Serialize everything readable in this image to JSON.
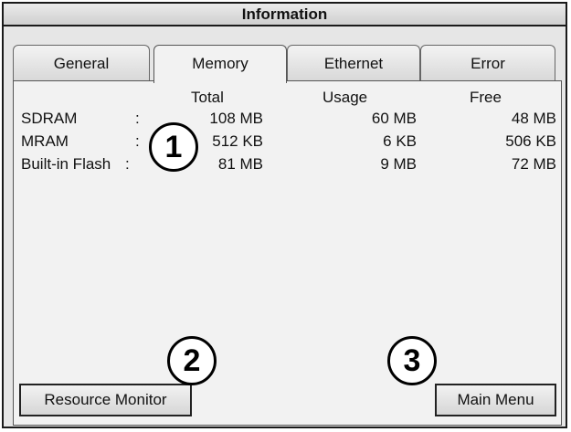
{
  "window": {
    "title": "Information"
  },
  "tabs": [
    {
      "label": "General"
    },
    {
      "label": "Memory",
      "active": true
    },
    {
      "label": "Ethernet"
    },
    {
      "label": "Error"
    }
  ],
  "memory_table": {
    "headers": {
      "total": "Total",
      "usage": "Usage",
      "free": "Free"
    },
    "rows": [
      {
        "label": "SDRAM",
        "sep": ":",
        "total": "108 MB",
        "usage": "60 MB",
        "free": "48 MB"
      },
      {
        "label": "MRAM",
        "sep": ":",
        "total": "512 KB",
        "usage": "6 KB",
        "free": "506 KB"
      },
      {
        "label": "Built-in Flash",
        "sep": ":",
        "total": "81 MB",
        "usage": "9 MB",
        "free": "72 MB"
      }
    ]
  },
  "buttons": {
    "resource_monitor": "Resource Monitor",
    "main_menu": "Main Menu"
  },
  "callouts": [
    "1",
    "2",
    "3"
  ]
}
